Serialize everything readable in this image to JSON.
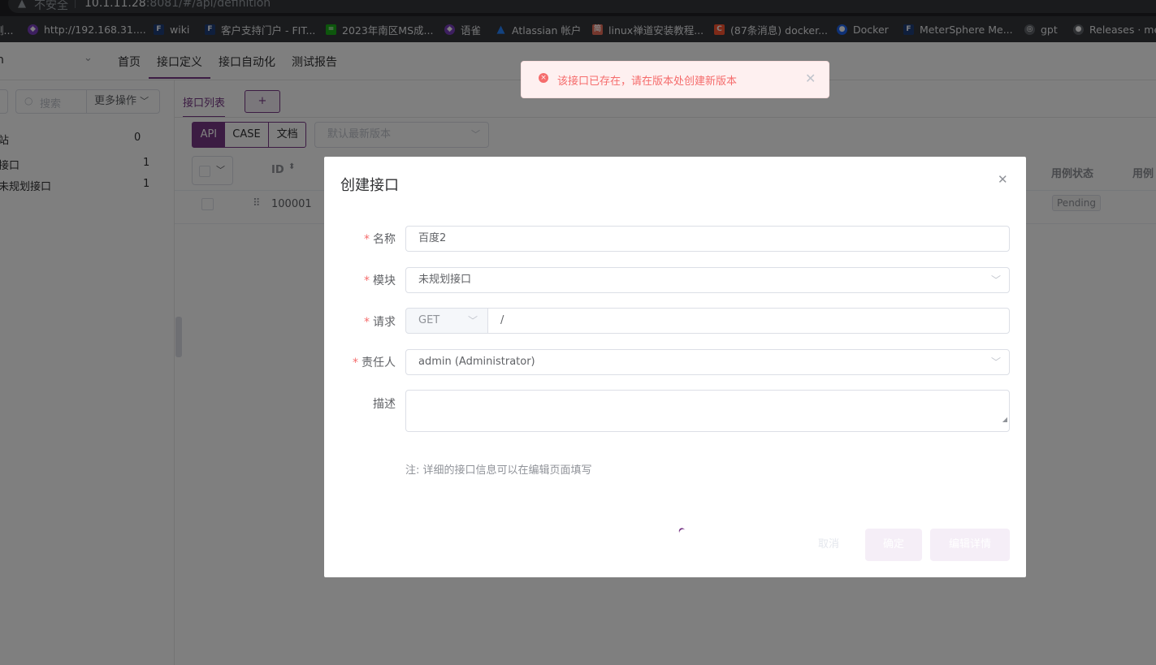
{
  "browser": {
    "security_label": "不安全",
    "url_host": "10.1.11.28",
    "url_path": ":8081/#/api/definition",
    "bookmarks": [
      {
        "label": "测...",
        "icon": "page-icon",
        "color": "#5f6368"
      },
      {
        "label": "http://192.168.31....",
        "icon": "app-icon",
        "color": "#7b3fbf"
      },
      {
        "label": "wiki",
        "icon": "fit2cloud-icon",
        "color": "#1f3f7a"
      },
      {
        "label": "客户支持门户 - FIT...",
        "icon": "fit2cloud-icon",
        "color": "#1f3f7a"
      },
      {
        "label": "2023年南区MS成...",
        "icon": "sheet-icon",
        "color": "#1aad19"
      },
      {
        "label": "语雀",
        "icon": "yuque-icon",
        "color": "#7b3fbf"
      },
      {
        "label": "Atlassian 帐户",
        "icon": "atlassian-icon",
        "color": "#2684ff"
      },
      {
        "label": "linux禅道安装教程...",
        "icon": "jianshu-icon",
        "color": "#ea6f5a"
      },
      {
        "label": "(87条消息) docker...",
        "icon": "csdn-icon",
        "color": "#fc5531"
      },
      {
        "label": "Docker",
        "icon": "docker-icon",
        "color": "#1d63ed"
      },
      {
        "label": "MeterSphere  Me...",
        "icon": "fit2cloud-icon",
        "color": "#1f3f7a"
      },
      {
        "label": "gpt",
        "icon": "globe-icon",
        "color": "#5f6368"
      },
      {
        "label": "Releases · met",
        "icon": "github-icon",
        "color": "#5f6368"
      }
    ]
  },
  "nav": {
    "project_chevron": "⌄",
    "items": [
      "首页",
      "接口定义",
      "接口自动化",
      "测试报告"
    ],
    "active_index": 1
  },
  "sidebar": {
    "search_placeholder": "搜索",
    "more_ops": "更多操作",
    "tree": [
      {
        "label": "站",
        "count": "0"
      },
      {
        "label": "接口",
        "count": "1"
      },
      {
        "label": "未规划接口",
        "count": "1"
      }
    ]
  },
  "main": {
    "tab_label": "接口列表",
    "add_tab": "+",
    "modes": [
      "API",
      "CASE",
      "文档"
    ],
    "version_placeholder": "默认最新版本",
    "columns": {
      "id": "ID",
      "case_status": "用例状态",
      "case_more": "用例"
    },
    "rows": [
      {
        "id": "100001",
        "status": "Pending"
      }
    ]
  },
  "toast": {
    "message": "该接口已存在，请在版本处创建新版本",
    "color": "#f56c6c"
  },
  "modal": {
    "title": "创建接口",
    "fields": {
      "name": {
        "label": "名称",
        "value": "百度2"
      },
      "module": {
        "label": "模块",
        "value": "未规划接口"
      },
      "request": {
        "label": "请求",
        "method": "GET",
        "path": "/"
      },
      "owner": {
        "label": "责任人",
        "value": "admin (Administrator)"
      },
      "description": {
        "label": "描述",
        "value": ""
      }
    },
    "note": "注: 详细的接口信息可以在编辑页面填写",
    "buttons": {
      "cancel": "取消",
      "confirm": "确定",
      "edit_detail": "编辑详情"
    },
    "accent_color": "#783887"
  }
}
